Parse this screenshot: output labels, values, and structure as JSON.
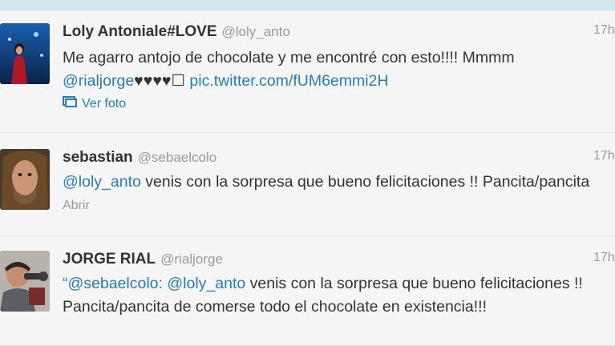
{
  "tweets": [
    {
      "name": "Loly Antoniale#LOVE",
      "handle": "@loly_anto",
      "time": "17h",
      "line1": "Me agarro antojo de chocolate y me encontré con esto!!!! Mmmm",
      "mention": "@rialjorge",
      "hearts": "♥♥♥♥☐",
      "pic_link": "pic.twitter.com/fUM6emmi2H",
      "action_label": "Ver foto",
      "action_icon": "photo-icon"
    },
    {
      "name": "sebastian",
      "handle": "@sebaelcolo",
      "time": "17h",
      "mention": "@loly_anto",
      "text": " venis con la sorpresa que bueno felicitaciones  !! Pancita/pancita",
      "action_label": "Abrir"
    },
    {
      "name": "JORGE RIAL",
      "handle": "@rialjorge",
      "time": "17h",
      "quote_open": "“",
      "mention1": "@sebaelcolo:",
      "mention2": "@loly_anto",
      "text": " venis con la sorpresa que bueno felicitaciones  !! Pancita/pancita de comerse todo el chocolate en existencia!!!"
    }
  ],
  "colors": {
    "link": "#2b7bb9",
    "muted": "#999999",
    "text": "#333333",
    "background": "#f5f5f5"
  }
}
